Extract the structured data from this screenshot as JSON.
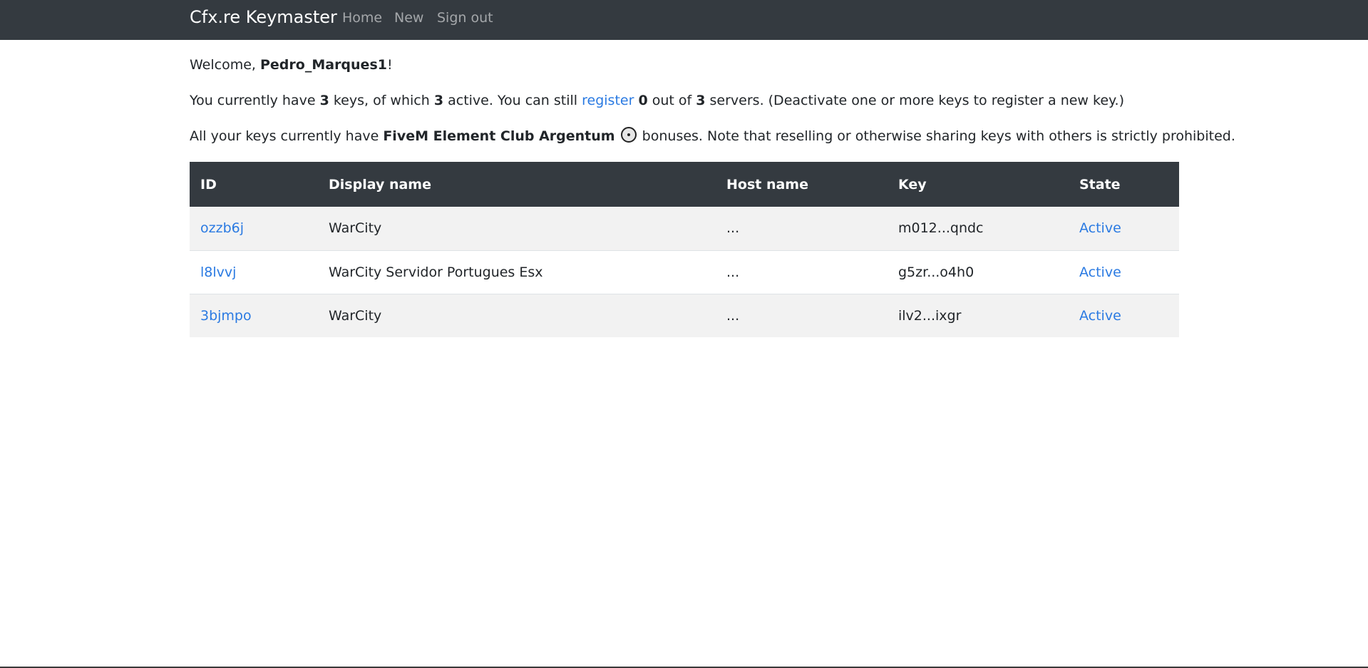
{
  "nav": {
    "brand": "Cfx.re Keymaster",
    "links": [
      "Home",
      "New",
      "Sign out"
    ]
  },
  "welcome": {
    "prefix": "Welcome, ",
    "username": "Pedro_Marques1",
    "suffix": "!"
  },
  "summary": {
    "t1": "You currently have ",
    "keys_count": "3",
    "t2": " keys, of which ",
    "active_count": "3",
    "t3": " active. You can still ",
    "register_link": "register",
    "t4": " ",
    "remaining": "0",
    "t5": " out of ",
    "max_servers": "3",
    "t6": " servers. (Deactivate one or more keys to register a new key.)"
  },
  "bonus": {
    "t1": "All your keys currently have ",
    "tier": "FiveM Element Club Argentum",
    "tier_icon": "argentum-coin-icon",
    "t2": " bonuses. Note that reselling or otherwise sharing keys with others is strictly prohibited."
  },
  "table": {
    "headers": [
      "ID",
      "Display name",
      "Host name",
      "Key",
      "State"
    ],
    "rows": [
      {
        "id": "ozzb6j",
        "display_name": "WarCity",
        "host_name": "...",
        "key": "m012...qndc",
        "state": "Active"
      },
      {
        "id": "l8lvvj",
        "display_name": "WarCity Servidor Portugues Esx",
        "host_name": "...",
        "key": "g5zr...o4h0",
        "state": "Active"
      },
      {
        "id": "3bjmpo",
        "display_name": "WarCity",
        "host_name": "...",
        "key": "ilv2...ixgr",
        "state": "Active"
      }
    ]
  },
  "colors": {
    "navbar": "#343a40",
    "link": "#2a7ae2",
    "row_stripe": "#f2f2f2"
  }
}
